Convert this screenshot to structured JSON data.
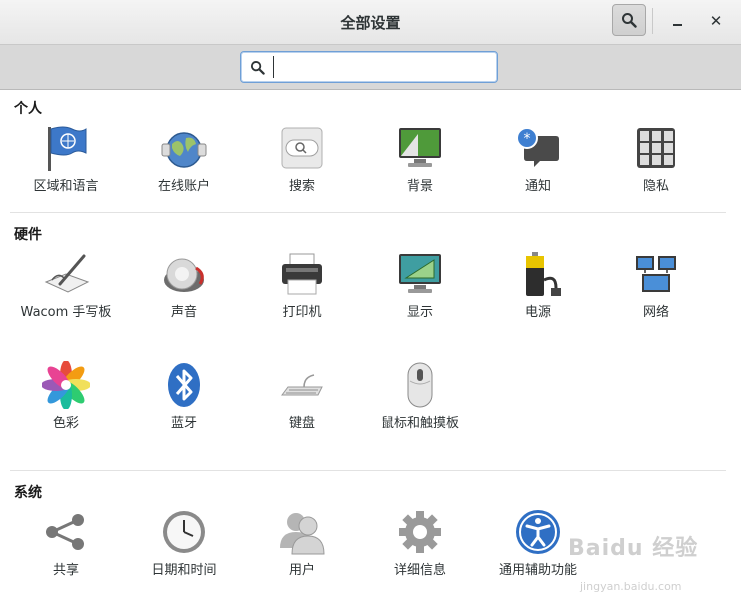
{
  "window": {
    "title": "全部设置"
  },
  "search": {
    "value": "",
    "placeholder": ""
  },
  "sections": {
    "personal": {
      "title": "个人",
      "items": [
        "区域和语言",
        "在线账户",
        "搜索",
        "背景",
        "通知",
        "隐私"
      ]
    },
    "hardware": {
      "title": "硬件",
      "items": [
        "Wacom 手写板",
        "声音",
        "打印机",
        "显示",
        "电源",
        "网络",
        "色彩",
        "蓝牙",
        "键盘",
        "鼠标和触摸板"
      ]
    },
    "system": {
      "title": "系统",
      "items": [
        "共享",
        "日期和时间",
        "用户",
        "详细信息",
        "通用辅助功能"
      ]
    }
  },
  "watermark": {
    "brand": "Baidu 经验",
    "url": "jingyan.baidu.com"
  },
  "colors": {
    "accent": "#4a90d9",
    "header_bg": "#ececec",
    "searchbar_bg": "#d8d8d8"
  }
}
